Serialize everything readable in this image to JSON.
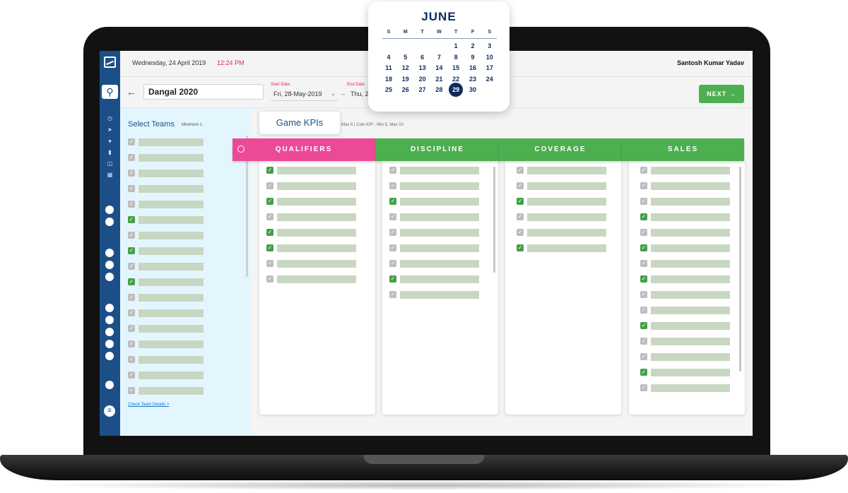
{
  "header": {
    "date": "Wednesday, 24 April 2019",
    "time": "12:24 PM",
    "user": "Santosh Kumar Yadav"
  },
  "toolbar": {
    "campaign_name": "Dangal 2020",
    "start_label": "Start Date",
    "start_value": "Fri, 28-May-2019",
    "end_label": "End Date",
    "end_value": "Thu, 2",
    "next_label": "NEXT"
  },
  "teams": {
    "title": "Select Teams",
    "minimum": "Minimum 1",
    "link": "Check Team Details >",
    "checked": [
      false,
      false,
      false,
      false,
      false,
      true,
      false,
      true,
      false,
      true,
      false,
      false,
      false,
      false,
      false,
      false,
      false
    ]
  },
  "kpis": {
    "card_title": "Game KPIs",
    "rule_text": "Max 6  |  Coin KPI - Min 5, Max 10",
    "columns": [
      {
        "title": "QUALIFIERS",
        "color": "#ec4a97",
        "checked": [
          true,
          false,
          true,
          false,
          true,
          true,
          false,
          false
        ]
      },
      {
        "title": "DISCIPLINE",
        "color": "#4caf50",
        "checked": [
          false,
          false,
          true,
          false,
          false,
          false,
          false,
          true,
          false
        ]
      },
      {
        "title": "COVERAGE",
        "color": "#4caf50",
        "checked": [
          false,
          false,
          true,
          false,
          false,
          true
        ]
      },
      {
        "title": "SALES",
        "color": "#4caf50",
        "checked": [
          false,
          false,
          false,
          true,
          false,
          true,
          false,
          true,
          false,
          false,
          true,
          false,
          false,
          true,
          false
        ]
      }
    ]
  },
  "calendar": {
    "month": "JUNE",
    "weekdays": [
      "S",
      "M",
      "T",
      "W",
      "T",
      "F",
      "S"
    ],
    "weeks": [
      [
        "",
        "",
        "",
        "",
        "",
        "1",
        "2",
        "3"
      ],
      [
        "4",
        "5",
        "6",
        "7",
        "8",
        "9",
        "10"
      ],
      [
        "11",
        "12",
        "13",
        "14",
        "15",
        "16",
        "17"
      ],
      [
        "18",
        "19",
        "20",
        "21",
        "22",
        "23",
        "24"
      ],
      [
        "25",
        "26",
        "27",
        "28",
        "29",
        "30",
        ""
      ]
    ],
    "selected": "29"
  }
}
